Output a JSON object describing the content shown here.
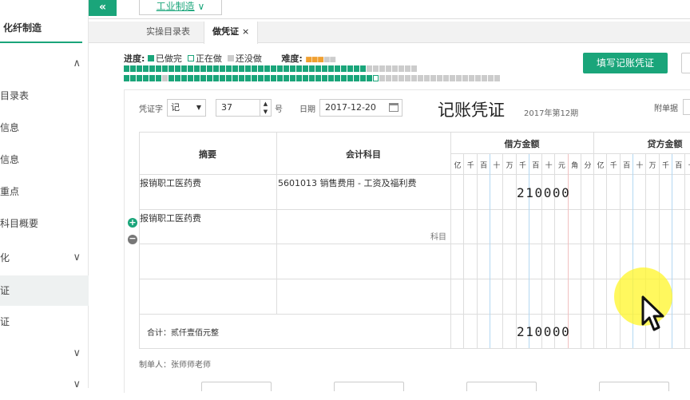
{
  "sidebar": {
    "title": "化纤制造",
    "items": [
      {
        "label": "",
        "chevron": "∧"
      },
      {
        "label": "目录表"
      },
      {
        "label": "信息"
      },
      {
        "label": "信息"
      },
      {
        "label": "重点"
      },
      {
        "label": "科目概要"
      },
      {
        "label": "化",
        "chevron": "∨"
      },
      {
        "label": "证",
        "active": true
      },
      {
        "label": "证"
      },
      {
        "label": "",
        "chevron": "∨"
      },
      {
        "label": "",
        "chevron": "∨"
      }
    ]
  },
  "top": {
    "collapse_glyph": "«",
    "dropdown_label": "工业制造",
    "dropdown_glyph": "∨"
  },
  "tabs": [
    {
      "label": "实操目录表"
    },
    {
      "label": "做凭证",
      "close": "×",
      "active": true
    }
  ],
  "progress": {
    "label": "进度:",
    "done": "已做完",
    "doing": "正在做",
    "todo": "还没做",
    "difficulty_label": "难度:",
    "difficulty_filled": "■■■",
    "difficulty_empty": "■■",
    "row1_done": 38,
    "row1_grey": 8,
    "row2_done": 6,
    "row2_grey": 1,
    "row2_done_b": 32,
    "row2_current": 1,
    "row2_grey_b": 19
  },
  "fill_button": "填写记账凭证",
  "voucher": {
    "word_label": "凭证字",
    "word_value": "记",
    "word_arrow": "▼",
    "number_value": "37",
    "spin_up": "▲",
    "spin_down": "▼",
    "hao_label": "号",
    "date_label": "日期",
    "date_value": "2017-12-20",
    "title": "记账凭证",
    "period": "2017年第12期",
    "attach_label": "附单据"
  },
  "table": {
    "head_summary": "摘要",
    "head_account": "会计科目",
    "head_debit": "借方金额",
    "head_credit": "贷方金额",
    "digits": [
      "亿",
      "千",
      "百",
      "十",
      "万",
      "千",
      "百",
      "十",
      "元",
      "角",
      "分"
    ],
    "credit_digits": [
      "亿",
      "千",
      "百",
      "十",
      "万",
      "千",
      "百",
      "十"
    ],
    "rows": [
      {
        "summary": "报销职工医药费",
        "account": "5601013 销售费用 - 工资及福利费",
        "debit": "210000"
      },
      {
        "summary": "报销职工医药费",
        "account_placeholder": "科目"
      }
    ],
    "total_label": "合计：贰仟壹佰元整",
    "total_debit": "210000"
  },
  "row_add_glyph": "+",
  "row_del_glyph": "−",
  "maker": "制单人：张师师老师",
  "colors": {
    "accent": "#1aa57a",
    "cursor_highlight": "#fff528"
  }
}
